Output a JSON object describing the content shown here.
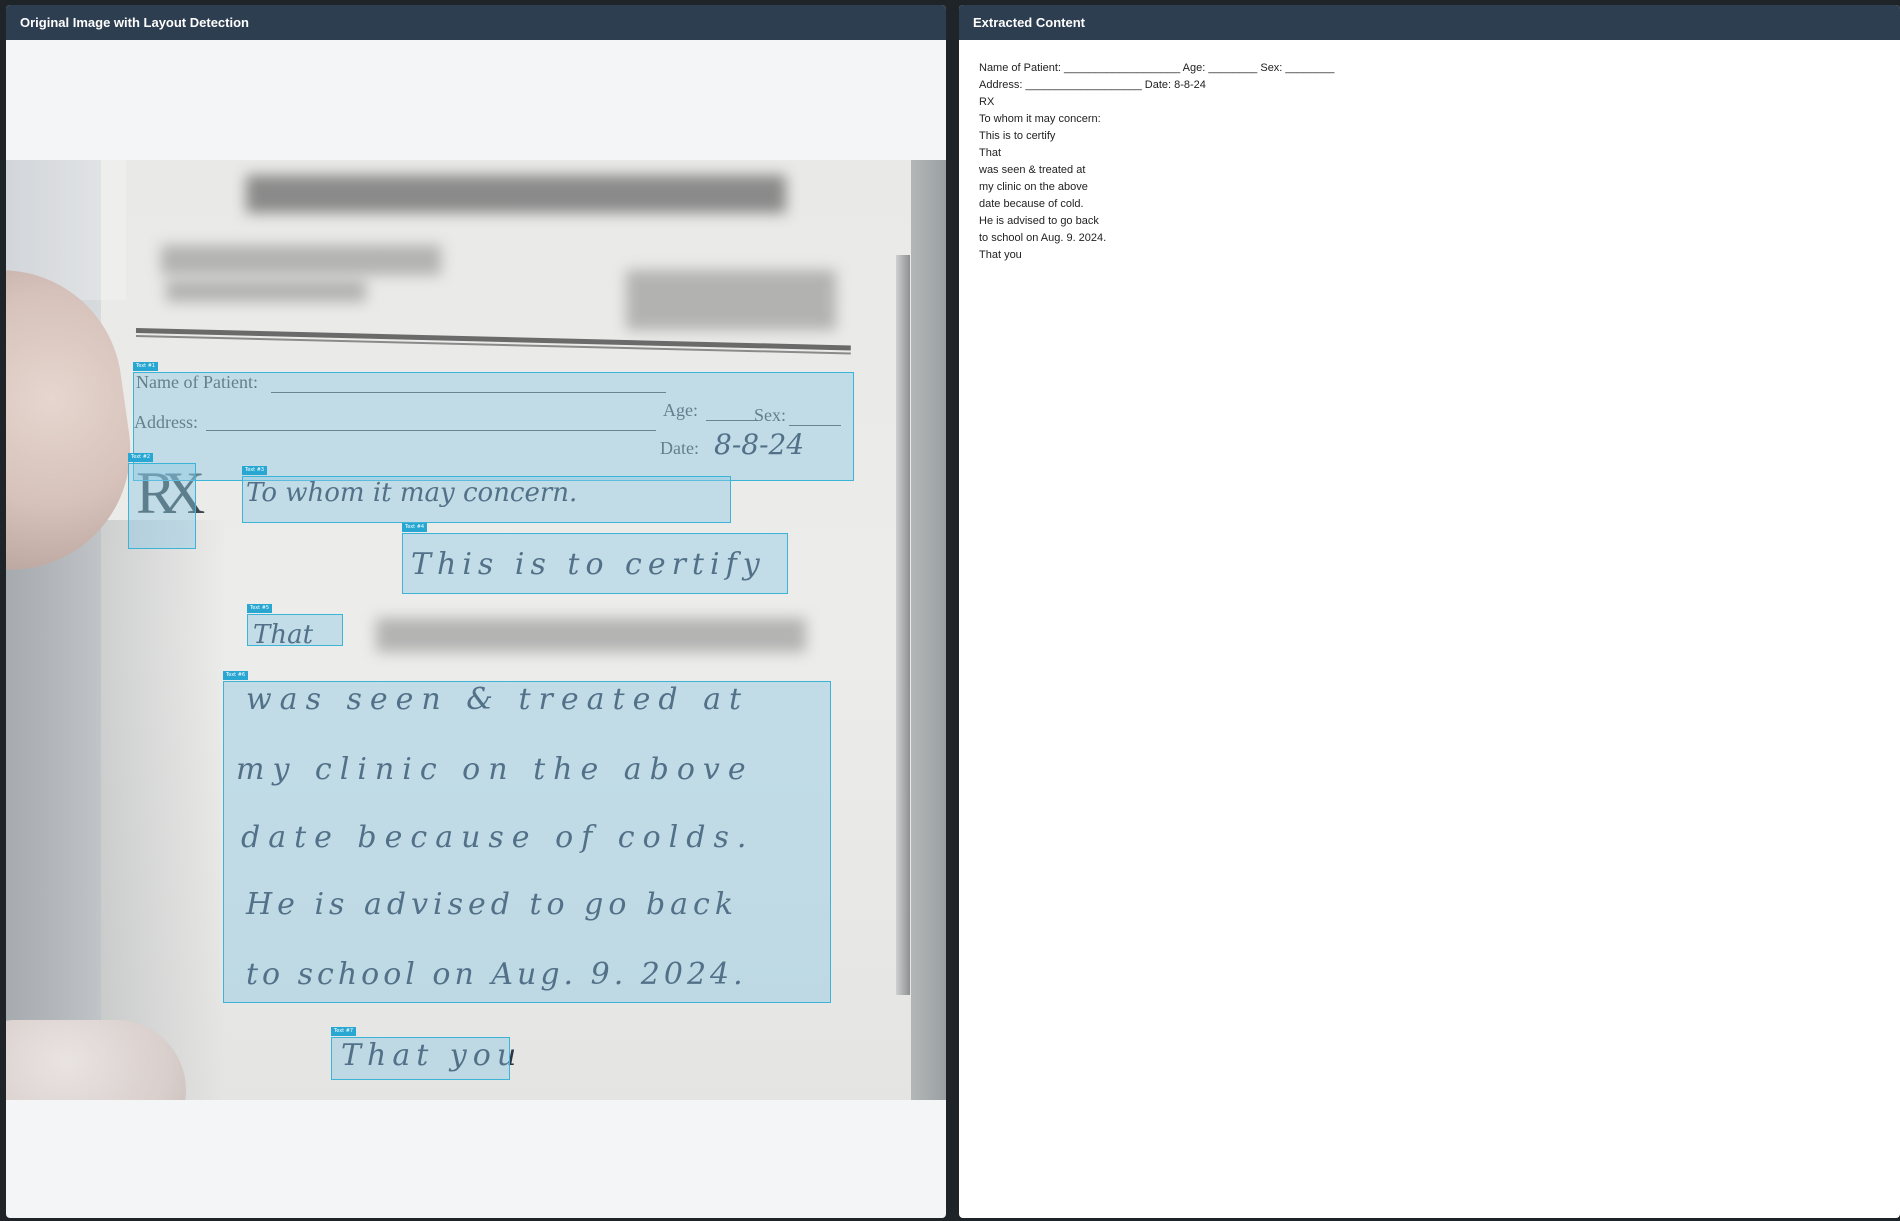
{
  "left_panel": {
    "title": "Original Image with Layout Detection",
    "form": {
      "name_label": "Name of Patient:",
      "age_label": "Age:",
      "sex_label": "Sex:",
      "address_label": "Address:",
      "date_label": "Date:"
    },
    "handwriting": {
      "date": "8-8-24",
      "line1": "To whom it may concern.",
      "line2": "This is to certify",
      "line3": "That",
      "line4": "was seen & treated at",
      "line5": "my clinic on the above",
      "line6": "date because of colds.",
      "line7": "He is advised to go back",
      "line8": "to school on Aug. 9. 2024.",
      "line9": "That you"
    },
    "rx_symbol": "RX",
    "detections": [
      {
        "label": "Text #1"
      },
      {
        "label": "Text #2"
      },
      {
        "label": "Text #3"
      },
      {
        "label": "Text #4"
      },
      {
        "label": "Text #5"
      },
      {
        "label": "Text #6"
      },
      {
        "label": "Text #7"
      }
    ],
    "colors": {
      "header": "#2d3e50",
      "detection_border": "#3bb4d8",
      "detection_fill": "rgba(135,200,228,0.42)"
    }
  },
  "right_panel": {
    "title": "Extracted Content",
    "lines": [
      "Name of Patient: ___________________ Age: ________ Sex: ________",
      "Address: ___________________ Date: 8-8-24",
      "RX",
      "To whom it may concern:",
      "This is to certify",
      "That",
      "was seen & treated at",
      "my clinic on the above",
      "date because of cold.",
      "He is advised to go back",
      "to school on Aug. 9. 2024.",
      "That you"
    ]
  }
}
